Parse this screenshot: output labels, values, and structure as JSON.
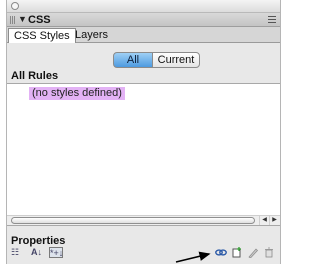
{
  "panel": {
    "group_title": "CSS",
    "disclosure": "▼",
    "tabs": [
      {
        "label": "CSS Styles"
      },
      {
        "label": "Layers"
      }
    ],
    "toggle": {
      "all_label": "All",
      "current_label": "Current",
      "selected": "All"
    },
    "rules": {
      "heading": "All Rules",
      "placeholder": "(no styles defined)"
    },
    "properties": {
      "heading": "Properties",
      "view_buttons": {
        "category": "☷",
        "alphabetical": "A↓",
        "set_only": "*+↓"
      }
    }
  },
  "colors": {
    "accent_selected": "#4d9ae0",
    "placeholder_highlight": "#e3b2f5",
    "arrow": "#000000"
  },
  "icons": [
    "close-icon",
    "gripper-icon",
    "options-menu-icon",
    "attach-style-sheet-icon",
    "new-rule-icon",
    "edit-icon",
    "trash-icon"
  ]
}
